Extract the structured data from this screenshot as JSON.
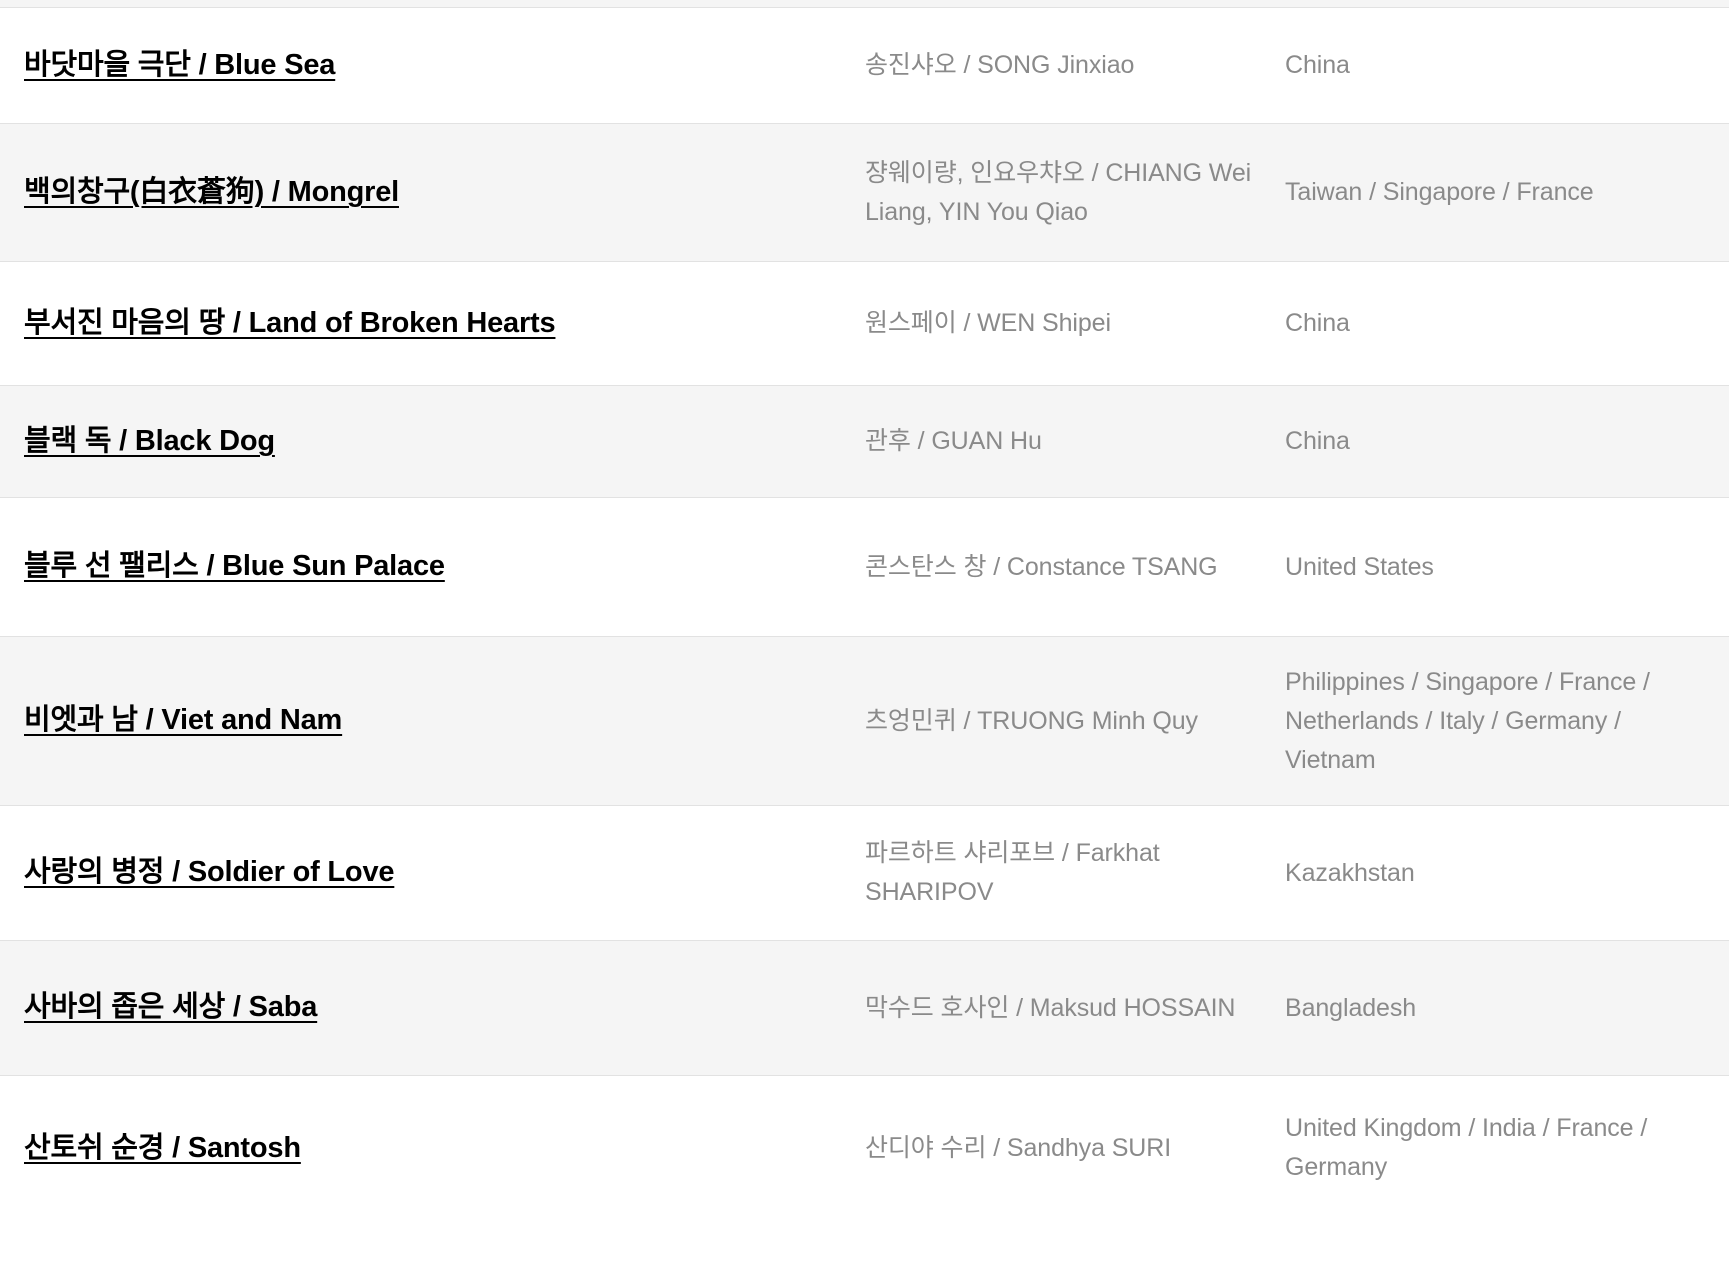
{
  "table": {
    "columns": [
      "title",
      "director",
      "country"
    ],
    "row_stripe_color": "#f5f5f5",
    "row_base_color": "#ffffff",
    "row_border_color": "#e2e2e2",
    "title_color": "#000000",
    "meta_color": "#8a8a8a",
    "rows": [
      {
        "title": "바닷마을 극단 / Blue Sea",
        "director": "송진샤오 / SONG Jinxiao",
        "country": "China"
      },
      {
        "title": "백의창구(白衣蒼狗) / Mongrel",
        "director": "쟝웨이량, 인요우챠오 / CHIANG Wei Liang, YIN You Qiao",
        "country": "Taiwan / Singapore / France"
      },
      {
        "title": "부서진 마음의 땅 / Land of Broken Hearts",
        "director": "원스페이 / WEN Shipei",
        "country": "China"
      },
      {
        "title": "블랙 독 / Black Dog",
        "director": "관후 / GUAN Hu",
        "country": "China"
      },
      {
        "title": "블루 선 팰리스 / Blue Sun Palace",
        "director": "콘스탄스 창 / Constance TSANG",
        "country": "United States"
      },
      {
        "title": "비엣과 남 / Viet and Nam",
        "director": "츠엉민퀴 / TRUONG Minh Quy",
        "country": "Philippines / Singapore / France / Netherlands / Italy / Germany / Vietnam"
      },
      {
        "title": "사랑의 병정 / Soldier of Love",
        "director": "파르하트 샤리포브 / Farkhat SHARIPOV",
        "country": "Kazakhstan"
      },
      {
        "title": "사바의 좁은 세상 / Saba",
        "director": "막수드 호사인 / Maksud HOSSAIN",
        "country": "Bangladesh"
      },
      {
        "title": "산토쉬 순경 / Santosh",
        "director": "산디야 수리 / Sandhya SURI",
        "country": "United Kingdom / India / France / Germany"
      }
    ]
  }
}
